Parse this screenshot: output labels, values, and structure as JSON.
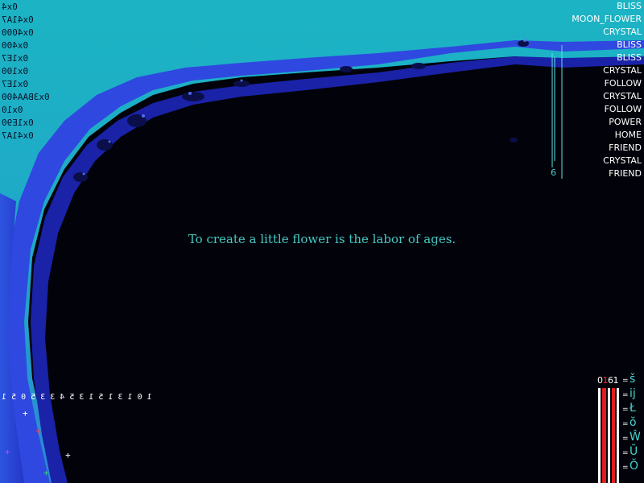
{
  "hud": {
    "hex_readouts": [
      "0x4",
      "0x41A7",
      "0x4000",
      "0x400",
      "0x1E7",
      "0x100",
      "0x1E7",
      "0x3BAA400",
      "0x10",
      "0x1E90",
      "0x41A7"
    ],
    "lower_digits": "1 0   1 3   1 5 1   3 5   4 3   3 5   0 5 1",
    "sparkles": [
      "+",
      "+",
      "+",
      "+",
      "+"
    ]
  },
  "word_list": [
    "BLISS",
    "MOON_FLOWER",
    "CRYSTAL",
    "BLISS",
    "BLISS",
    "CRYSTAL",
    "FOLLOW",
    "CRYSTAL",
    "FOLLOW",
    "POWER",
    "HOME",
    "FRIEND",
    "CRYSTAL",
    "FRIEND"
  ],
  "bar_count": "6",
  "quote": "To create a little flower is the labor of ages.",
  "meter": {
    "count_lead": "0",
    "count_mid": "1",
    "count_tail": "61",
    "bars": [
      {
        "color": "#ffffff"
      },
      {
        "color": "#e01e1e"
      },
      {
        "color": "#ffffff"
      },
      {
        "color": "#e01e1e"
      },
      {
        "color": "#ffffff"
      }
    ]
  },
  "glyphs": [
    {
      "eq": "=",
      "glyph": "š"
    },
    {
      "eq": "=",
      "glyph": "ĳ"
    },
    {
      "eq": "=",
      "glyph": "Ł"
    },
    {
      "eq": "=",
      "glyph": "ŏ"
    },
    {
      "eq": "=",
      "glyph": "Ŵ"
    },
    {
      "eq": "=",
      "glyph": "Ŭ"
    },
    {
      "eq": "=",
      "glyph": "Ŏ"
    }
  ],
  "colors": {
    "sky_cyan": "#1fb0c4",
    "sky_teal": "#22a0c8",
    "deep_blue": "#2a3ad8",
    "void": "#02030a",
    "text_cyan": "#46c8c3"
  }
}
